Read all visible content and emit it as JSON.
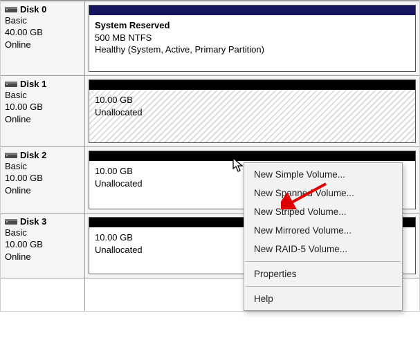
{
  "disks": [
    {
      "name": "Disk 0",
      "type": "Basic",
      "size": "40.00 GB",
      "status": "Online"
    },
    {
      "name": "Disk 1",
      "type": "Basic",
      "size": "10.00 GB",
      "status": "Online"
    },
    {
      "name": "Disk 2",
      "type": "Basic",
      "size": "10.00 GB",
      "status": "Online"
    },
    {
      "name": "Disk 3",
      "type": "Basic",
      "size": "10.00 GB",
      "status": "Online"
    }
  ],
  "vol0": {
    "title": "System Reserved",
    "line2": "500 MB NTFS",
    "line3": "Healthy (System, Active, Primary Partition)"
  },
  "vol1": {
    "size": "10.00 GB",
    "state": "Unallocated"
  },
  "vol2": {
    "size": "10.00 GB",
    "state": "Unallocated"
  },
  "vol3": {
    "size": "10.00 GB",
    "state": "Unallocated"
  },
  "menu": {
    "m0": "New Simple Volume...",
    "m1": "New Spanned Volume...",
    "m2": "New Striped Volume...",
    "m3": "New Mirrored Volume...",
    "m4": "New RAID-5 Volume...",
    "m5": "Properties",
    "m6": "Help"
  }
}
